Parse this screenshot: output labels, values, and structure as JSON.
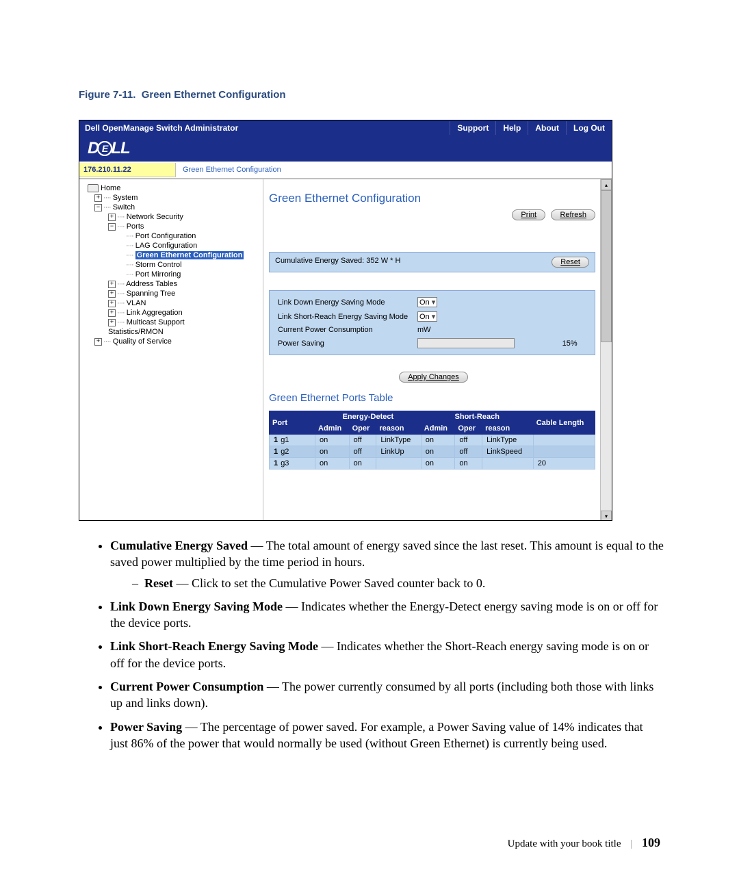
{
  "figure": {
    "label": "Figure 7-11.",
    "title": "Green Ethernet Configuration"
  },
  "topbar": {
    "title": "Dell OpenManage Switch Administrator",
    "links": [
      "Support",
      "Help",
      "About",
      "Log Out"
    ]
  },
  "logo": "DELL",
  "crumb": {
    "ip": "176.210.11.22",
    "page": "Green Ethernet Configuration"
  },
  "tree": {
    "home": "Home",
    "system": "System",
    "switch": "Switch",
    "net_sec": "Network Security",
    "ports": "Ports",
    "port_cfg": "Port Configuration",
    "lag_cfg": "LAG Configuration",
    "green": "Green Ethernet Configuration",
    "storm": "Storm Control",
    "mirror": "Port Mirroring",
    "addr": "Address Tables",
    "stp": "Spanning Tree",
    "vlan": "VLAN",
    "lag": "Link Aggregation",
    "mcast": "Multicast Support",
    "stats": "Statistics/RMON",
    "qos": "Quality of Service"
  },
  "main": {
    "heading": "Green Ethernet Configuration",
    "print": "Print",
    "refresh": "Refresh",
    "energy_saved": "Cumulative Energy Saved: 352 W * H",
    "reset": "Reset",
    "link_down_label": "Link Down Energy Saving Mode",
    "link_down_val": "On",
    "short_reach_label": "Link Short-Reach Energy Saving Mode",
    "short_reach_val": "On",
    "power_cons_label": "Current Power Consumption",
    "power_cons_unit": "mW",
    "power_save_label": "Power Saving",
    "power_save_pct": "15%",
    "apply": "Apply Changes",
    "ports_heading": "Green Ethernet Ports Table",
    "cols": {
      "port": "Port",
      "energy_detect": "Energy-Detect",
      "short_reach": "Short-Reach",
      "cable": "Cable Length",
      "admin": "Admin",
      "oper": "Oper",
      "reason": "reason"
    },
    "rows": [
      {
        "idx": "1",
        "port": "g1",
        "ed_admin": "on",
        "ed_oper": "off",
        "ed_reason": "LinkType",
        "sr_admin": "on",
        "sr_oper": "off",
        "sr_reason": "LinkType",
        "cable": ""
      },
      {
        "idx": "1",
        "port": "g2",
        "ed_admin": "on",
        "ed_oper": "off",
        "ed_reason": "LinkUp",
        "sr_admin": "on",
        "sr_oper": "off",
        "sr_reason": "LinkSpeed",
        "cable": ""
      },
      {
        "idx": "1",
        "port": "g3",
        "ed_admin": "on",
        "ed_oper": "on",
        "ed_reason": "",
        "sr_admin": "on",
        "sr_oper": "on",
        "sr_reason": "",
        "cable": "20"
      }
    ]
  },
  "desc": {
    "b1_term": "Cumulative Energy Saved",
    "b1_text": " — The total amount of energy saved since the last reset. This amount is equal to the saved power multiplied by the time period in hours.",
    "b1a_term": "Reset",
    "b1a_text": " — Click to set the Cumulative Power Saved counter back to 0.",
    "b2_term": "Link Down Energy Saving Mode",
    "b2_text": " — Indicates whether the Energy-Detect energy saving mode is on or off for the device ports.",
    "b3_term": "Link Short-Reach Energy Saving Mode",
    "b3_text": " — Indicates whether the Short-Reach energy saving mode is on or off for the device ports.",
    "b4_term": "Current Power Consumption",
    "b4_text": " — The power currently consumed by all ports (including both those with links up and links down).",
    "b5_term": "Power Saving",
    "b5_text": " — The percentage of power saved. For example, a Power Saving value of 14% indicates that just 86% of the power that would normally be used (without Green Ethernet) is currently being used."
  },
  "footer": {
    "text": "Update with your book title",
    "page": "109"
  }
}
